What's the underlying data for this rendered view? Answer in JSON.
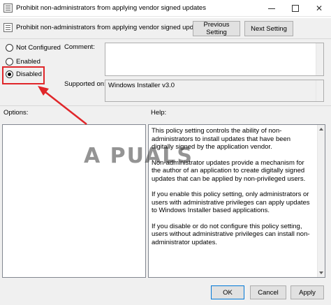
{
  "window": {
    "title": "Prohibit non-administrators from applying vendor signed updates",
    "close_glyph": "✕"
  },
  "header": {
    "policy_name": "Prohibit non-administrators from applying vendor signed updates",
    "previous_label": "Previous Setting",
    "next_label": "Next Setting"
  },
  "state": {
    "options": [
      {
        "label": "Not Configured",
        "checked": false
      },
      {
        "label": "Enabled",
        "checked": false
      },
      {
        "label": "Disabled",
        "checked": true
      }
    ]
  },
  "fields": {
    "comment_label": "Comment:",
    "comment_value": "",
    "supported_label": "Supported on:",
    "supported_value": "Windows Installer v3.0"
  },
  "panes": {
    "options_label": "Options:",
    "help_label": "Help:",
    "help_paragraphs": [
      "This policy setting controls the ability of non-administrators to install updates that have been digitally signed by the application vendor.",
      "Non-administrator updates provide a mechanism for the author of an application to create digitally signed updates that can be applied by non-privileged users.",
      "If you enable this policy setting, only administrators or users with administrative privileges can apply updates to Windows Installer based applications.",
      "If you disable or do not configure this policy setting, users without administrative privileges can install non-administrator updates."
    ]
  },
  "watermark": "A  PUALS",
  "footer": {
    "ok_label": "OK",
    "cancel_label": "Cancel",
    "apply_label": "Apply"
  },
  "annotation": {
    "highlight_color": "#e0262a"
  }
}
